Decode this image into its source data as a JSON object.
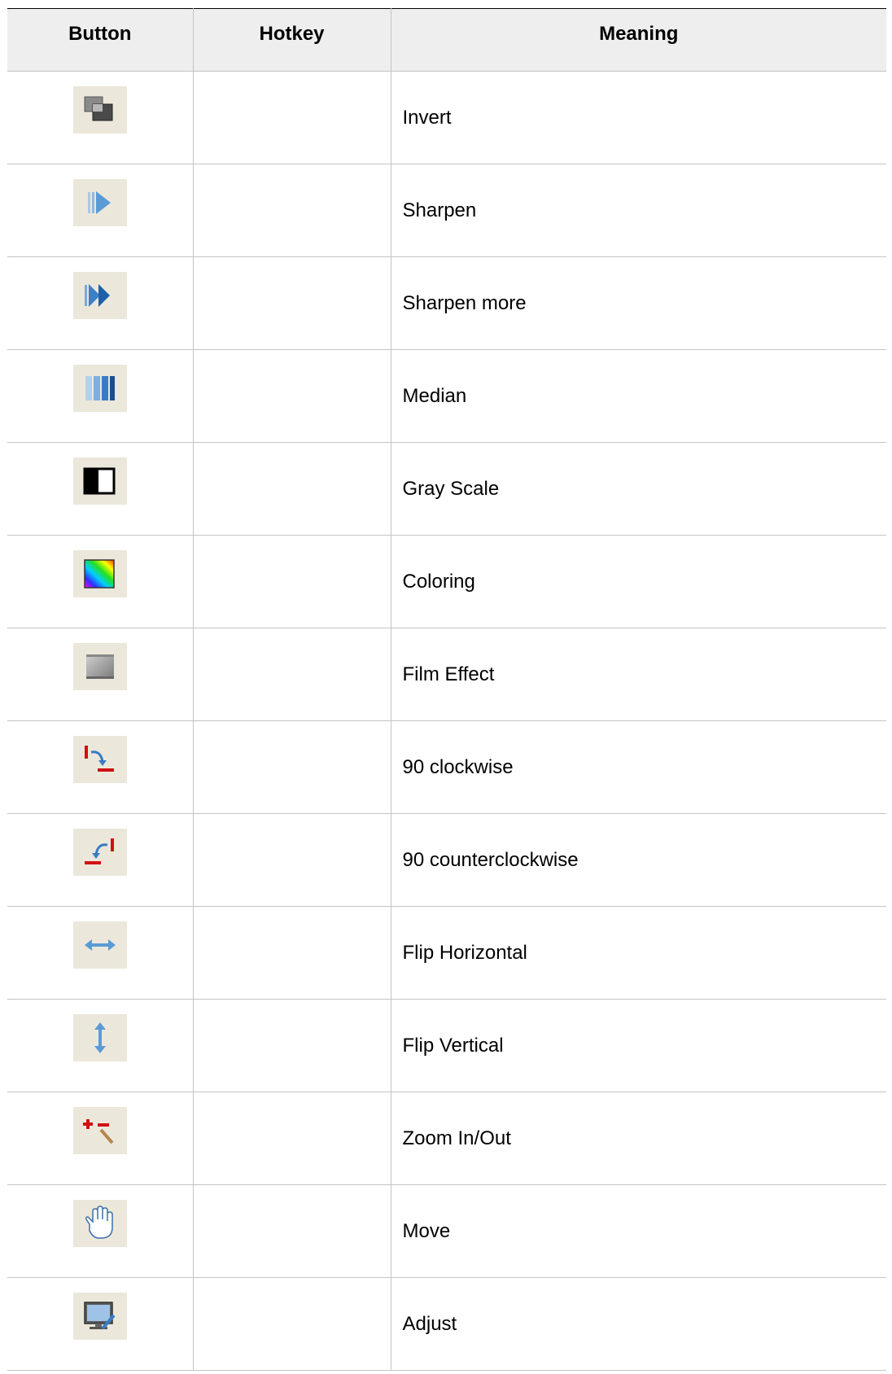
{
  "table": {
    "headers": {
      "button": "Button",
      "hotkey": "Hotkey",
      "meaning": "Meaning"
    },
    "rows": [
      {
        "icon": "invert-icon",
        "hotkey": "",
        "meaning": "Invert"
      },
      {
        "icon": "sharpen-icon",
        "hotkey": "",
        "meaning": "Sharpen"
      },
      {
        "icon": "sharpen-more-icon",
        "hotkey": "",
        "meaning": "Sharpen more"
      },
      {
        "icon": "median-icon",
        "hotkey": "",
        "meaning": "Median"
      },
      {
        "icon": "gray-scale-icon",
        "hotkey": "",
        "meaning": "Gray Scale"
      },
      {
        "icon": "coloring-icon",
        "hotkey": "",
        "meaning": "Coloring"
      },
      {
        "icon": "film-effect-icon",
        "hotkey": "",
        "meaning": "Film Effect"
      },
      {
        "icon": "rotate-clockwise-icon",
        "hotkey": "",
        "meaning": "90 clockwise"
      },
      {
        "icon": "rotate-counterclockwise-icon",
        "hotkey": "",
        "meaning": "90 counterclockwise"
      },
      {
        "icon": "flip-horizontal-icon",
        "hotkey": "",
        "meaning": "Flip Horizontal"
      },
      {
        "icon": "flip-vertical-icon",
        "hotkey": "",
        "meaning": "Flip Vertical"
      },
      {
        "icon": "zoom-in-out-icon",
        "hotkey": "",
        "meaning": "Zoom In/Out"
      },
      {
        "icon": "move-hand-icon",
        "hotkey": "",
        "meaning": "Move"
      },
      {
        "icon": "adjust-icon",
        "hotkey": "",
        "meaning": "Adjust"
      }
    ]
  }
}
